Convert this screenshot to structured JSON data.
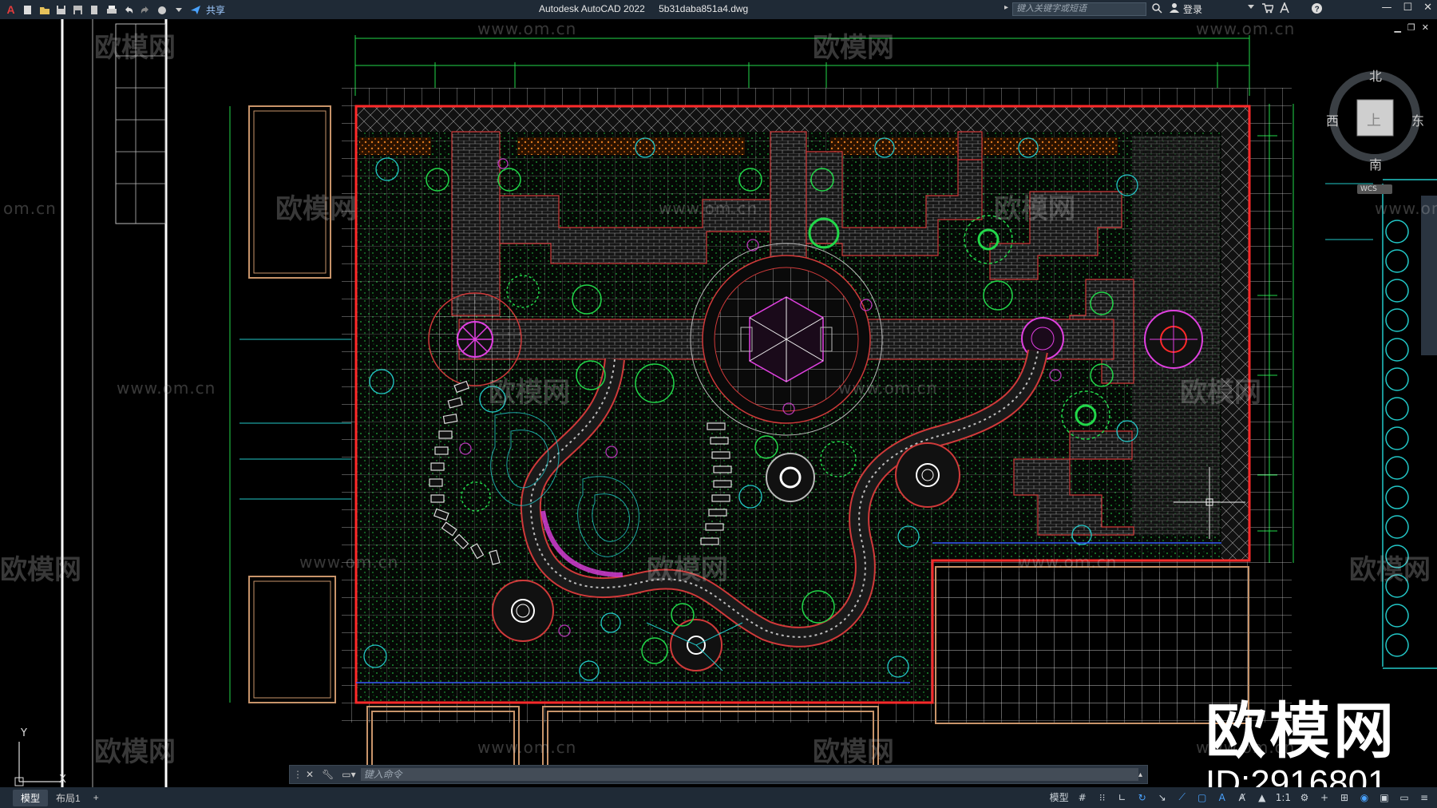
{
  "app": {
    "name": "Autodesk AutoCAD 2022",
    "file": "5b31daba851a4.dwg",
    "share_label": "共享",
    "search_placeholder": "键入关键字或短语",
    "login_label": "登录"
  },
  "viewcube": {
    "north": "北",
    "south": "南",
    "east": "东",
    "west": "西",
    "top_face": "上",
    "wcs": "WCS"
  },
  "command": {
    "placeholder": "键入命令"
  },
  "status": {
    "tabs": [
      {
        "label": "模型",
        "active": true
      },
      {
        "label": "布局1",
        "active": false
      }
    ],
    "add_tab": "+",
    "model_label": "模型",
    "scale": "1:1"
  },
  "ucs": {
    "y_label": "Y",
    "x_label": "X"
  },
  "watermark": {
    "brand_cn": "欧模网",
    "url": "www.om.cn",
    "url_short": "om.cn",
    "id_text": "ID:2916801"
  },
  "colors": {
    "titlebar": "#1f2a36",
    "boundary_red": "#ff2a2a",
    "plan_green": "#22d84a",
    "paving_gray": "#bfbfbf",
    "accent_cyan": "#22c7c7",
    "magenta": "#e040e0"
  }
}
